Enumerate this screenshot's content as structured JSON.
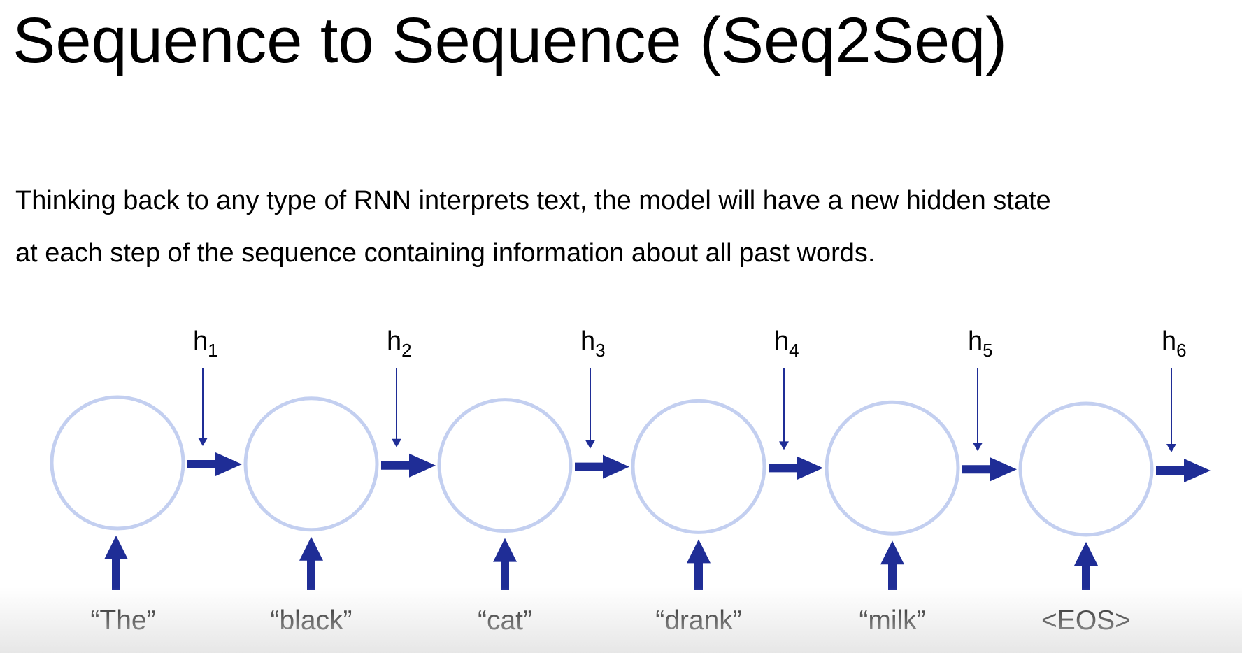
{
  "slide": {
    "title": "Sequence to Sequence (Seq2Seq)",
    "body_lines": [
      "Thinking back to any type of RNN interprets text, the model will have a new hidden state",
      "at each step of the sequence containing information about all past words."
    ]
  },
  "diagram": {
    "colors": {
      "node_stroke": "#c3cff0",
      "arrow": "#1f2d96"
    },
    "steps": [
      {
        "input": "“The”",
        "hidden": "h",
        "hidden_index": "1"
      },
      {
        "input": "“black”",
        "hidden": "h",
        "hidden_index": "2"
      },
      {
        "input": "“cat”",
        "hidden": "h",
        "hidden_index": "3"
      },
      {
        "input": "“drank”",
        "hidden": "h",
        "hidden_index": "4"
      },
      {
        "input": "“milk”",
        "hidden": "h",
        "hidden_index": "5"
      },
      {
        "input": "<EOS>",
        "hidden": "h",
        "hidden_index": "6"
      }
    ]
  }
}
